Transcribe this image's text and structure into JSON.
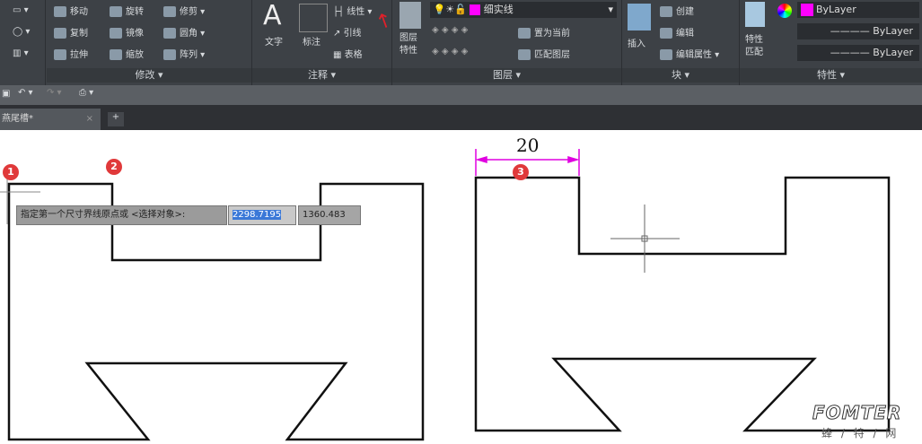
{
  "ribbon": {
    "modify": {
      "title": "修改 ▾",
      "items": [
        "移动",
        "旋转",
        "修剪",
        "复制",
        "镜像",
        "圆角",
        "拉伸",
        "缩放",
        "阵列"
      ]
    },
    "annotation": {
      "title": "注释 ▾",
      "text": "文字",
      "dim": "标注",
      "linear": "线性",
      "leader": "引线",
      "table": "表格"
    },
    "layers": {
      "title": "图层 ▾",
      "props": "图层\n特性",
      "layer_name": "细实线",
      "set_current": "置为当前",
      "match": "匹配图层"
    },
    "block": {
      "title": "块 ▾",
      "insert": "插入",
      "create": "创建",
      "edit": "编辑",
      "edit_attr": "编辑属性"
    },
    "properties": {
      "title": "特性 ▾",
      "match": "特性\n匹配",
      "color": "ByLayer",
      "linetype": "ByLayer",
      "lineweight": "ByLayer"
    }
  },
  "tabs": {
    "active": "燕尾槽*",
    "close": "×",
    "add": "+"
  },
  "command": {
    "prompt": "指定第一个尺寸界线原点或 <选择对象>:",
    "x": "2298.7195",
    "y": "1360.483"
  },
  "drawing": {
    "dimension": "20",
    "badges": [
      "1",
      "2",
      "3"
    ]
  },
  "watermark": {
    "brand": "FOMTER",
    "sub": "蜂 / 特 / 网"
  },
  "colors": {
    "magenta": "#ff00ff",
    "dim": "#e000e0"
  }
}
